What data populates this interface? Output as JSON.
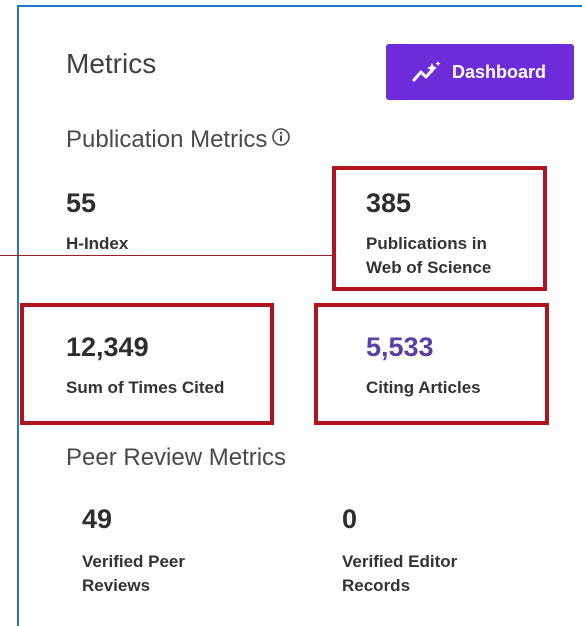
{
  "header": {
    "title": "Metrics",
    "dashboard_label": "Dashboard",
    "dashboard_icon": "trending-sparkle-icon"
  },
  "publication_metrics": {
    "heading": "Publication Metrics",
    "info_icon": "info-circle-icon",
    "h_index": {
      "value": "55",
      "label": "H-Index"
    },
    "publications": {
      "value": "385",
      "label_line1": "Publications in",
      "label_line2": "Web of Science"
    },
    "times_cited": {
      "value": "12,349",
      "label": "Sum of Times Cited"
    },
    "citing_articles": {
      "value": "5,533",
      "label": "Citing Articles"
    }
  },
  "peer_review_metrics": {
    "heading": "Peer Review Metrics",
    "verified_reviews": {
      "value": "49",
      "label_line1": "Verified Peer",
      "label_line2": "Reviews"
    },
    "editor_records": {
      "value": "0",
      "label_line1": "Verified Editor",
      "label_line2": "Records"
    }
  },
  "colors": {
    "accent": "#6e2bd9",
    "link": "#5b3ea6",
    "highlight": "#b0141f",
    "panel_border": "#1f7ac8"
  }
}
